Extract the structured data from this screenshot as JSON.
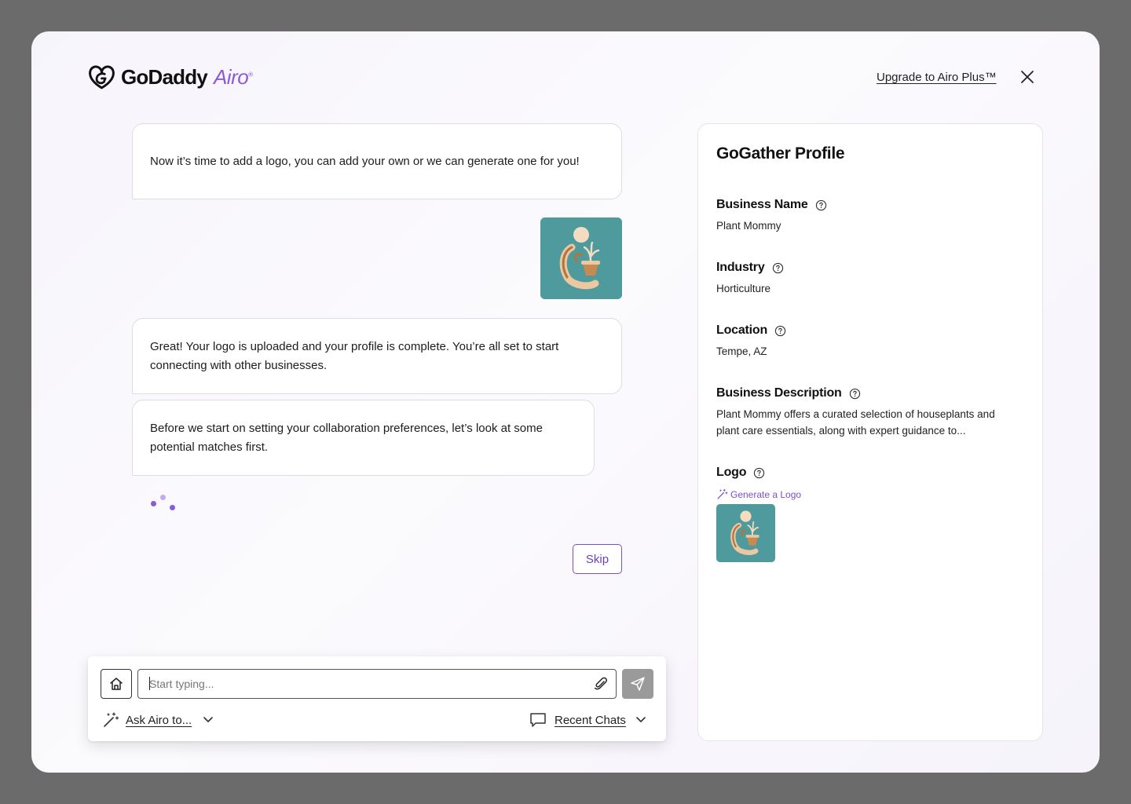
{
  "header": {
    "brand_name": "GoDaddy",
    "brand_product": "Airo",
    "upgrade_link": "Upgrade to Airo Plus™"
  },
  "chat": {
    "messages": [
      {
        "text": "Now it’s time to add a logo, you can add your own or we can generate one for you!"
      },
      {
        "text": "Great! Your logo is uploaded and your profile is complete. You’re all set to start connecting with other businesses."
      },
      {
        "text": "Before we start on setting your collaboration preferences, let’s look at some potential matches first."
      }
    ],
    "skip_label": "Skip"
  },
  "composer": {
    "placeholder": "Start typing...",
    "ask_label": "Ask Airo to...",
    "recent_label": "Recent Chats"
  },
  "profile": {
    "title": "GoGather Profile",
    "fields": [
      {
        "label": "Business Name",
        "value": "Plant Mommy"
      },
      {
        "label": "Industry",
        "value": "Horticulture"
      },
      {
        "label": "Location",
        "value": "Tempe, AZ"
      },
      {
        "label": "Business Description",
        "value": "Plant Mommy offers a curated selection of houseplants and plant care essentials, along with expert guidance to..."
      }
    ],
    "logo_label": "Logo",
    "generate_logo": "Generate a Logo"
  },
  "colors": {
    "accent": "#7b4fd0",
    "logo_bg": "#4e9a9c",
    "overlay": "#6b6b6b"
  },
  "icons": [
    "heart-logo-icon",
    "close-icon",
    "home-icon",
    "paperclip-icon",
    "send-icon",
    "magic-wand-icon",
    "chevron-down-icon",
    "chat-bubble-icon",
    "help-circle-icon"
  ]
}
